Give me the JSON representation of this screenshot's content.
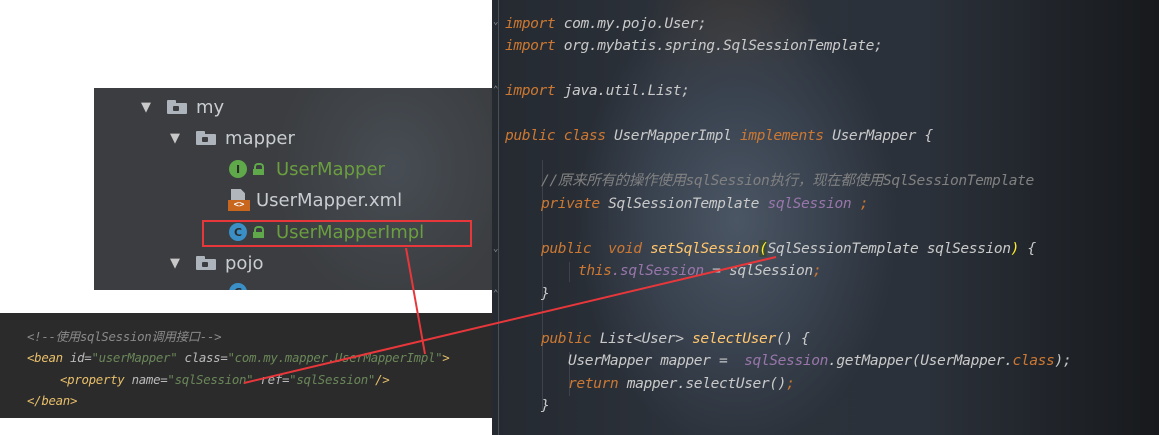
{
  "editor": {
    "lines": {
      "l1_kw": "import",
      "l1_rest": " com.my.pojo.User;",
      "l2_kw": "import",
      "l2_rest": " org.mybatis.spring.SqlSessionTemplate;",
      "l3_kw": "import",
      "l3_rest": " java.util.List;",
      "l4_kw1": "public class",
      "l4_name": " UserMapperImpl ",
      "l4_kw2": "implements",
      "l4_rest": " UserMapper {",
      "l5_comment": "//原来所有的操作使用sqlSession执行，现在都使用SqlSessionTemplate",
      "l6_kw": "private",
      "l6_type": " SqlSessionTemplate ",
      "l6_field": "sqlSession",
      "l6_end": " ;",
      "l7_kw": "public  void ",
      "l7_method": "setSqlSession",
      "l7_open": "(",
      "l7_params": "SqlSessionTemplate sqlSession",
      "l7_close": ")",
      "l7_end": " {",
      "l8_kw": "this",
      "l8_field": ".sqlSession",
      "l8_rest": " = sqlSession",
      "l8_end": ";",
      "l9": "}",
      "l10_kw": "public",
      "l10_type": " List<User> ",
      "l10_method": "selectUser",
      "l10_rest": "() {",
      "l11_a": "UserMapper mapper =  ",
      "l11_field": "sqlSession",
      "l11_b": ".getMapper(UserMapper.",
      "l11_kw": "class",
      "l11_c": ");",
      "l12_kw": "return",
      "l12_rest": " mapper.selectUser()",
      "l12_end": ";",
      "l13": "}"
    }
  },
  "tree": {
    "items": [
      {
        "label": "my"
      },
      {
        "label": "mapper"
      },
      {
        "label": "UserMapper",
        "badge": "I"
      },
      {
        "label": "UserMapper.xml",
        "badge": "<>"
      },
      {
        "label": "UserMapperImpl",
        "badge": "C"
      },
      {
        "label": "pojo"
      },
      {
        "badge": "C"
      }
    ]
  },
  "xml": {
    "comment": "<!--使用sqlSession调用接口-->",
    "bean_open": "<bean",
    "bean_id_attr": " id=",
    "bean_id_val": "\"userMapper\"",
    "bean_class_attr": " class=",
    "bean_class_val": "\"com.my.mapper.UserMapperImpl\"",
    "bean_gt": ">",
    "prop_open": "<property",
    "prop_name_attr": " name=",
    "prop_name_val": "\"sqlSession\"",
    "prop_ref_attr": " ref=",
    "prop_ref_val": "\"sqlSession\"",
    "prop_close": "/>",
    "bean_close": "</bean>"
  },
  "colors": {
    "annotation": "#e8373b",
    "keyword": "#cc7832",
    "field": "#9876aa",
    "method": "#ffc66d",
    "xml_value": "#6a8759"
  },
  "icons": [
    "chevron-down-icon",
    "folder-icon",
    "interface-icon",
    "class-icon",
    "xml-file-icon",
    "lock-icon"
  ]
}
